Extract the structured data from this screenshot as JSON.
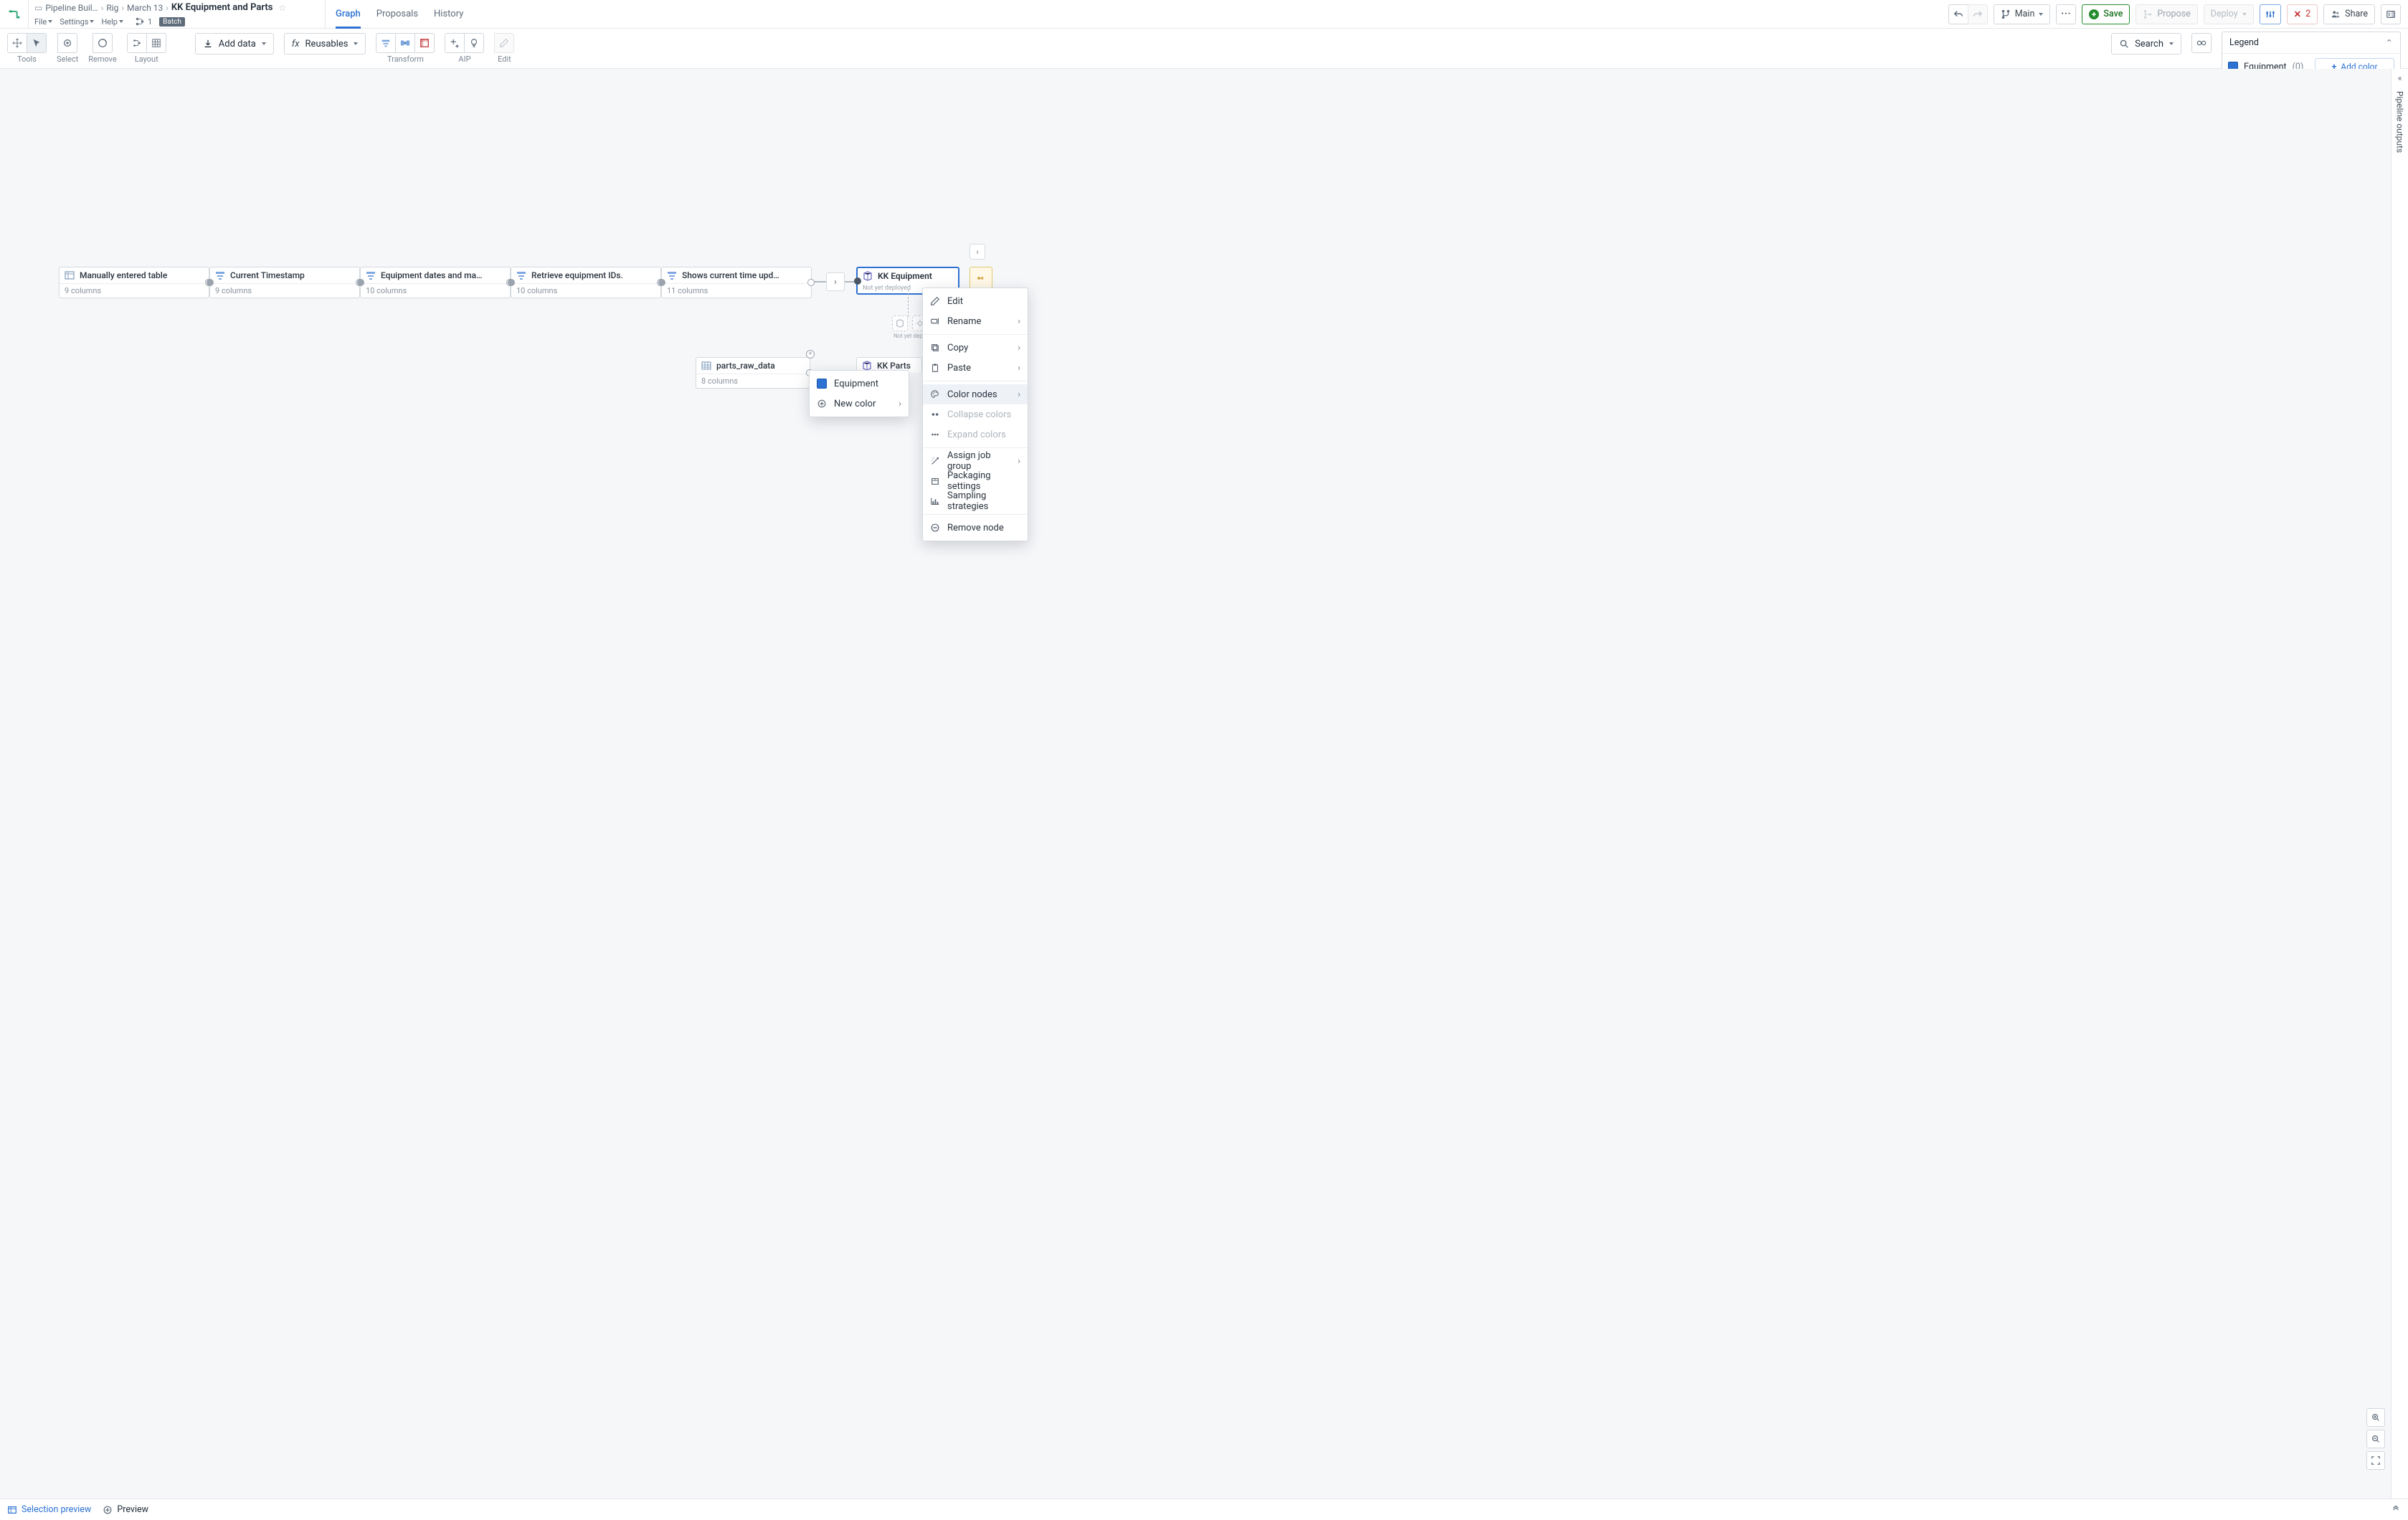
{
  "breadcrumb": {
    "app": "Pipeline Buil…",
    "parts": [
      "Rig",
      "March 13"
    ],
    "title": "KK Equipment and Parts"
  },
  "menus": {
    "file": "File",
    "settings": "Settings",
    "help": "Help",
    "branch_count": "1",
    "batch_badge": "Batch"
  },
  "tabs": {
    "graph": "Graph",
    "proposals": "Proposals",
    "history": "History"
  },
  "topbar": {
    "branch": "Main",
    "save": "Save",
    "propose": "Propose",
    "deploy": "Deploy",
    "errors": "2",
    "share": "Share"
  },
  "toolbar": {
    "tools": "Tools",
    "select": "Select",
    "remove": "Remove",
    "layout": "Layout",
    "add_data": "Add data",
    "reusables": "Reusables",
    "transform": "Transform",
    "aip": "AIP",
    "edit": "Edit",
    "search": "Search"
  },
  "legend": {
    "title": "Legend",
    "item": "Equipment",
    "count": "(0)",
    "add": "Add color"
  },
  "nodes": {
    "a": {
      "title": "Manually entered table",
      "sub": "9 columns"
    },
    "b": {
      "title": "Current Timestamp",
      "sub": "9 columns"
    },
    "c": {
      "title": "Equipment dates and ma…",
      "sub": "10 columns"
    },
    "d": {
      "title": "Retrieve equipment IDs.",
      "sub": "10 columns"
    },
    "e": {
      "title": "Shows current time upd…",
      "sub": "11 columns"
    },
    "f": {
      "title": "KK Equipment",
      "note": "Not yet deployed"
    },
    "g": {
      "title": "parts_raw_data",
      "sub": "8 columns"
    },
    "h": {
      "title": "KK Parts"
    }
  },
  "context": {
    "edit": "Edit",
    "rename": "Rename",
    "copy": "Copy",
    "paste": "Paste",
    "color": "Color nodes",
    "collapse_c": "Collapse colors",
    "expand_c": "Expand colors",
    "assign": "Assign job group",
    "packaging": "Packaging settings",
    "sampling": "Sampling strategies",
    "remove": "Remove node"
  },
  "color_sub": {
    "equipment": "Equipment",
    "new": "New color"
  },
  "rail": {
    "label": "Pipeline outputs"
  },
  "footer": {
    "sel_preview": "Selection preview",
    "preview": "Preview"
  }
}
